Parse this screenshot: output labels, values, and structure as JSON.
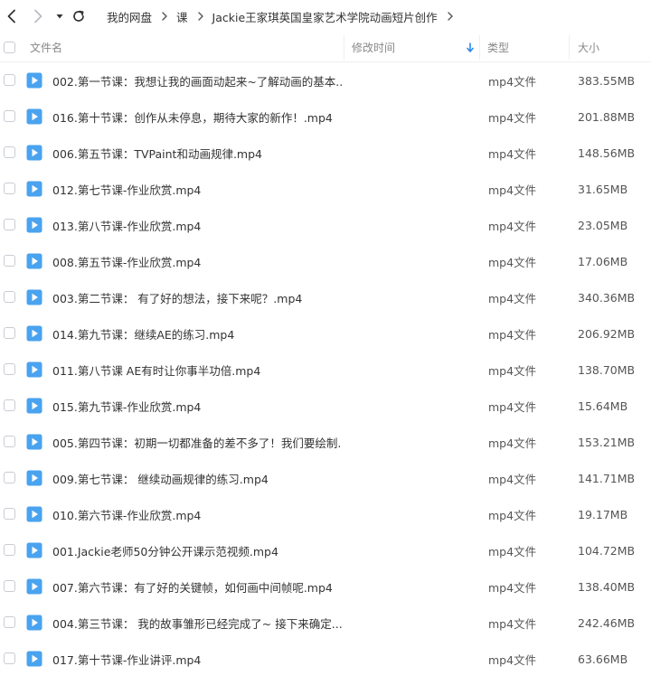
{
  "toolbar": {
    "back_icon": "chevron-left-icon",
    "forward_icon": "chevron-right-icon",
    "history_icon": "caret-down-icon",
    "refresh_icon": "refresh-icon"
  },
  "breadcrumb": [
    "我的网盘",
    "课",
    "Jackie王家琪英国皇家艺术学院动画短片创作"
  ],
  "header": {
    "name": "文件名",
    "modified": "修改时间",
    "type": "类型",
    "size": "大小",
    "sort_icon": "sort-down-arrow-icon"
  },
  "colors": {
    "accent": "#2b8be9",
    "file_icon": "#4aa3ef",
    "text": "#333333",
    "header_text": "#888888"
  },
  "files": [
    {
      "name": "002.第一节课：我想让我的画面动起来~了解动画的基本...",
      "type": "mp4文件",
      "size": "383.55MB"
    },
    {
      "name": "016.第十节课：创作从未停息，期待大家的新作！.mp4",
      "type": "mp4文件",
      "size": "201.88MB"
    },
    {
      "name": "006.第五节课：TVPaint和动画规律.mp4",
      "type": "mp4文件",
      "size": "148.56MB"
    },
    {
      "name": "012.第七节课-作业欣赏.mp4",
      "type": "mp4文件",
      "size": "31.65MB"
    },
    {
      "name": "013.第八节课-作业欣赏.mp4",
      "type": "mp4文件",
      "size": "23.05MB"
    },
    {
      "name": "008.第五节课-作业欣赏.mp4",
      "type": "mp4文件",
      "size": "17.06MB"
    },
    {
      "name": "003.第二节课： 有了好的想法，接下来呢？.mp4",
      "type": "mp4文件",
      "size": "340.36MB"
    },
    {
      "name": "014.第九节课：继续AE的练习.mp4",
      "type": "mp4文件",
      "size": "206.92MB"
    },
    {
      "name": "011.第八节课 AE有时让你事半功倍.mp4",
      "type": "mp4文件",
      "size": "138.70MB"
    },
    {
      "name": "015.第九节课-作业欣赏.mp4",
      "type": "mp4文件",
      "size": "15.64MB"
    },
    {
      "name": "005.第四节课：初期一切都准备的差不多了！我们要绘制...",
      "type": "mp4文件",
      "size": "153.21MB"
    },
    {
      "name": "009.第七节课： 继续动画规律的练习.mp4",
      "type": "mp4文件",
      "size": "141.71MB"
    },
    {
      "name": "010.第六节课-作业欣赏.mp4",
      "type": "mp4文件",
      "size": "19.17MB"
    },
    {
      "name": "001.Jackie老师50分钟公开课示范视频.mp4",
      "type": "mp4文件",
      "size": "104.72MB"
    },
    {
      "name": "007.第六节课：有了好的关键帧，如何画中间帧呢.mp4",
      "type": "mp4文件",
      "size": "138.40MB"
    },
    {
      "name": "004.第三节课： 我的故事雏形已经完成了~ 接下来确定...",
      "type": "mp4文件",
      "size": "242.46MB"
    },
    {
      "name": "017.第十节课-作业讲评.mp4",
      "type": "mp4文件",
      "size": "63.66MB"
    }
  ]
}
